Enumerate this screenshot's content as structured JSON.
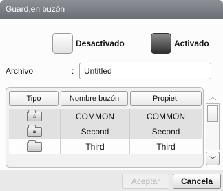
{
  "dialog": {
    "title": "Guard,en buzón"
  },
  "toggle": {
    "off_label": "Desactivado",
    "on_label": "Activado",
    "selected": "Activado"
  },
  "file": {
    "label": "Archivo",
    "colon": ":",
    "value": "Untitled"
  },
  "table": {
    "headers": [
      "Tipo",
      "Nombre buzón",
      "Propiet."
    ],
    "rows": [
      {
        "type_icon": "home-folder-icon",
        "type_glyph": "⌂",
        "name": "COMMON",
        "owner": "COMMON"
      },
      {
        "type_icon": "locked-folder-icon",
        "type_glyph": "🔒︎",
        "name": "Second",
        "owner": "Second"
      },
      {
        "type_icon": "folder-icon",
        "type_glyph": "",
        "name": "Third",
        "owner": "Third"
      }
    ]
  },
  "scrollbar": {
    "up_glyph": "︿",
    "down_glyph": "﹀"
  },
  "footer": {
    "accept_label": "Aceptar",
    "cancel_label": "Cancela"
  }
}
